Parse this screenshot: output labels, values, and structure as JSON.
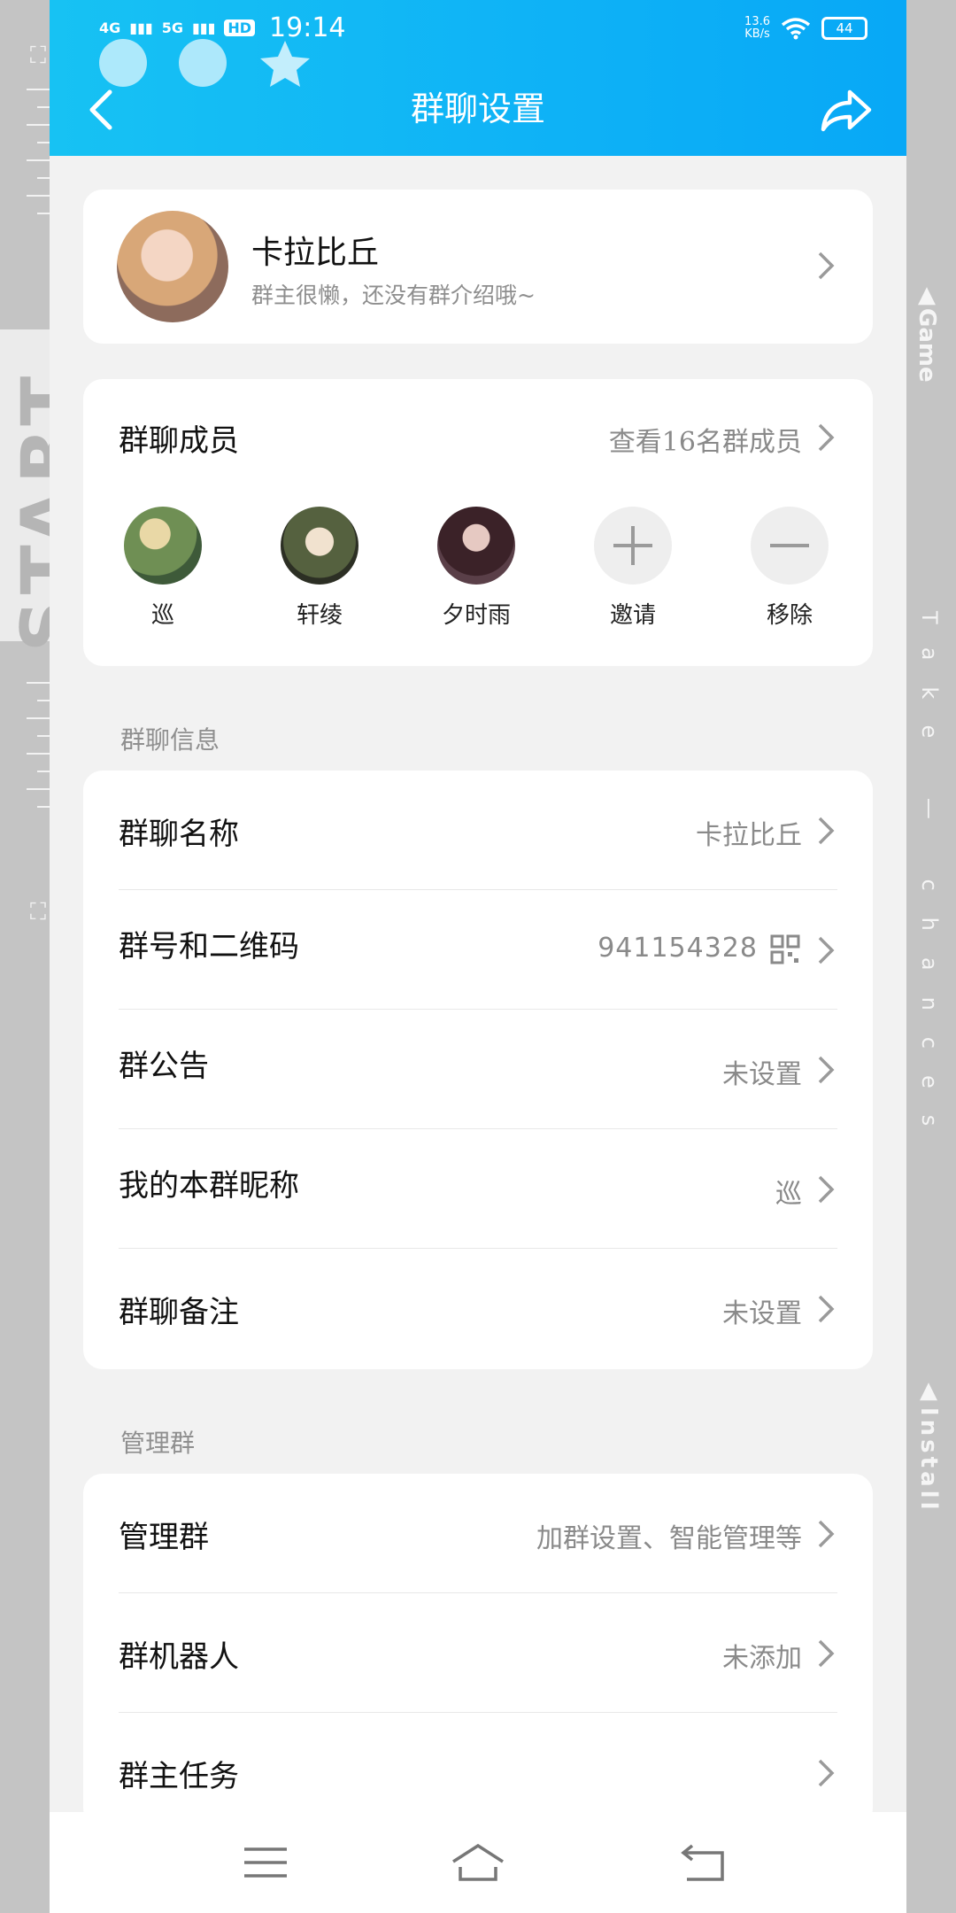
{
  "statusbar": {
    "network1": "4G",
    "network2": "5G",
    "hd": "HD",
    "time": "19:14",
    "speed_value": "13.6",
    "speed_unit": "KB/s",
    "battery": "44"
  },
  "header": {
    "title": "群聊设置"
  },
  "group": {
    "name": "卡拉比丘",
    "description": "群主很懒，还没有群介绍哦~"
  },
  "members": {
    "title": "群聊成员",
    "view_all": "查看16名群成员",
    "list": [
      {
        "name": "巡"
      },
      {
        "name": "轩绫"
      },
      {
        "name": "夕时雨"
      }
    ],
    "invite_label": "邀请",
    "remove_label": "移除"
  },
  "info_section": {
    "label": "群聊信息",
    "rows": [
      {
        "title": "群聊名称",
        "value": "卡拉比丘"
      },
      {
        "title": "群号和二维码",
        "value": "941154328"
      },
      {
        "title": "群公告",
        "value": "未设置"
      },
      {
        "title": "我的本群昵称",
        "value": "巡"
      },
      {
        "title": "群聊备注",
        "value": "未设置"
      }
    ]
  },
  "manage_section": {
    "label": "管理群",
    "rows": [
      {
        "title": "管理群",
        "value": "加群设置、智能管理等"
      },
      {
        "title": "群机器人",
        "value": "未添加"
      },
      {
        "title": "群主任务",
        "value": ""
      }
    ]
  },
  "side": {
    "start": "START",
    "game": "▲Game",
    "motto": "Take — chances",
    "install": "▲Install"
  },
  "colors": {
    "header_gradient_start": "#17c2f3",
    "header_gradient_end": "#08a8f6",
    "page_bg": "#f2f2f2",
    "secondary_text": "#8a8a8a"
  }
}
